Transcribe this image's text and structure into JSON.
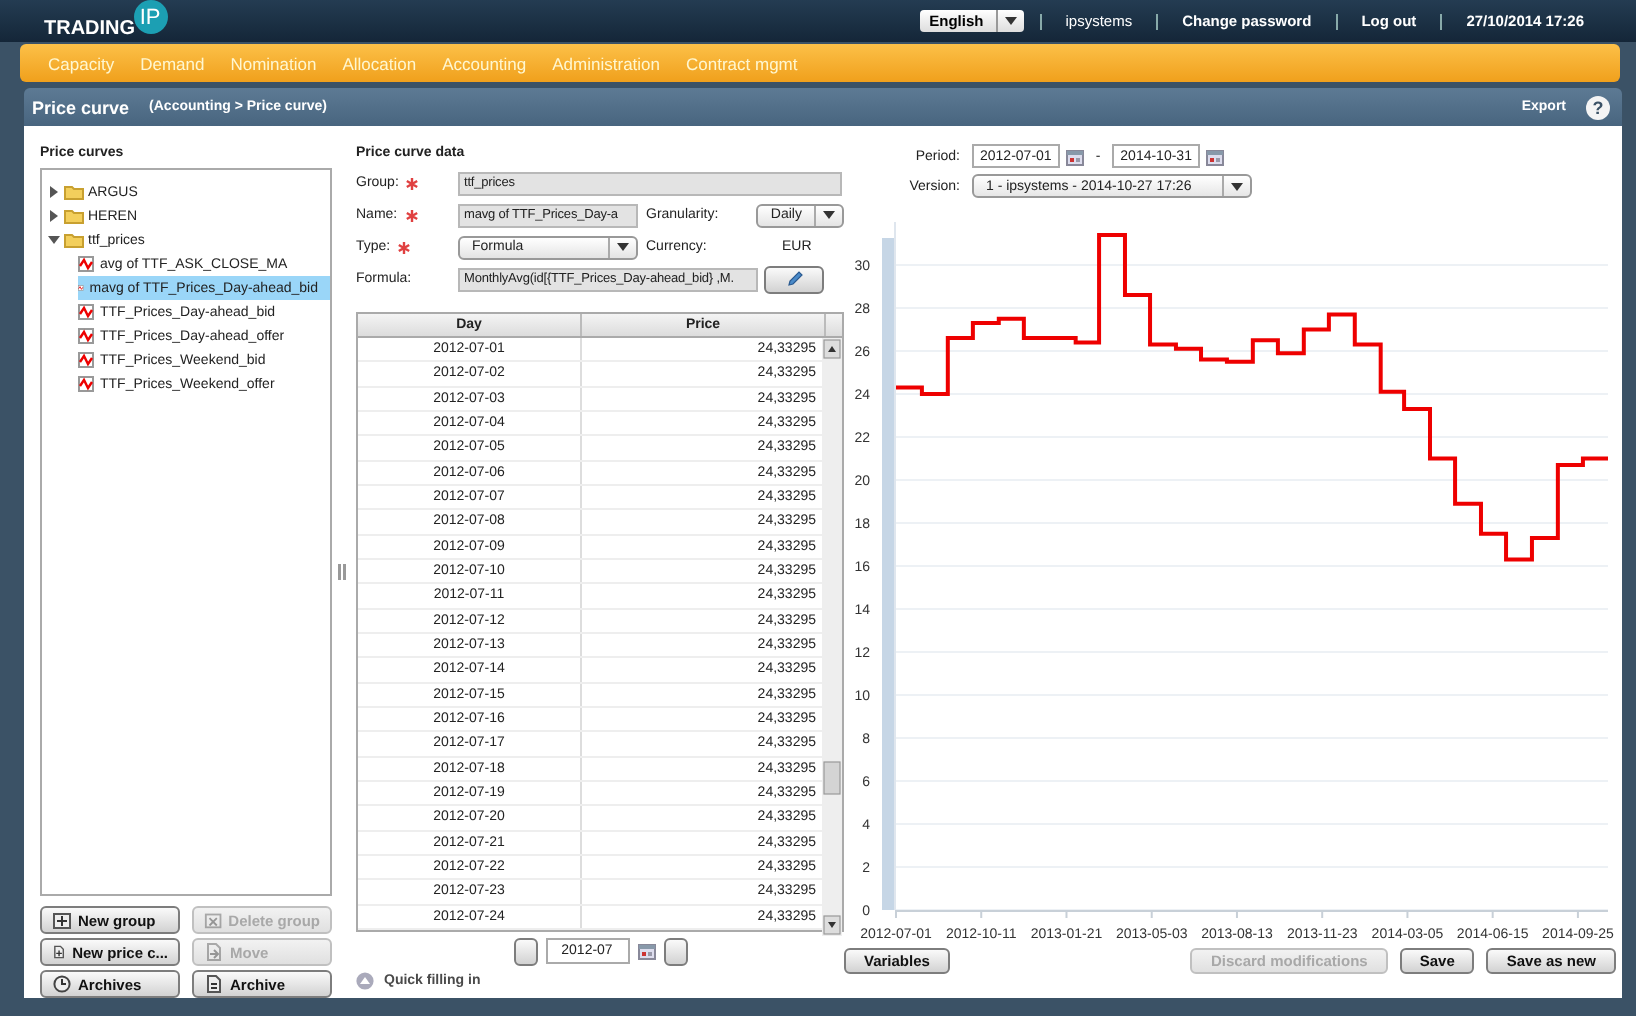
{
  "header": {
    "logo_text": "TRADING",
    "logo_badge": "IP",
    "language": "English",
    "user": "ipsystems",
    "links": [
      "Change password",
      "Log out"
    ],
    "datetime": "27/10/2014 17:26"
  },
  "nav": [
    "Capacity",
    "Demand",
    "Nomination",
    "Allocation",
    "Accounting",
    "Administration",
    "Contract mgmt"
  ],
  "page": {
    "title": "Price curve",
    "breadcrumb": "(Accounting > Price curve)",
    "export": "Export",
    "help": "?"
  },
  "tree": {
    "title": "Price curves",
    "items": [
      {
        "label": "ARGUS",
        "expanded": false
      },
      {
        "label": "HEREN",
        "expanded": false
      },
      {
        "label": "ttf_prices",
        "expanded": true,
        "children": [
          {
            "label": "avg of TTF_ASK_CLOSE_MA",
            "selected": false
          },
          {
            "label": "mavg of TTF_Prices_Day-ahead_bid",
            "selected": true
          },
          {
            "label": "TTF_Prices_Day-ahead_bid",
            "selected": false
          },
          {
            "label": "TTF_Prices_Day-ahead_offer",
            "selected": false
          },
          {
            "label": "TTF_Prices_Weekend_bid",
            "selected": false
          },
          {
            "label": "TTF_Prices_Weekend_offer",
            "selected": false
          }
        ]
      }
    ]
  },
  "tree_buttons": [
    {
      "label": "New group",
      "kind": "addgroup",
      "disabled": false
    },
    {
      "label": "Delete group",
      "kind": "delgroup",
      "disabled": true
    },
    {
      "label": "New price c...",
      "kind": "newcurve",
      "disabled": false
    },
    {
      "label": "Move",
      "kind": "move",
      "disabled": true
    },
    {
      "label": "Archives",
      "kind": "history",
      "disabled": false
    },
    {
      "label": "Archive",
      "kind": "archive",
      "disabled": false
    }
  ],
  "form": {
    "title": "Price curve data",
    "group": {
      "label": "Group:",
      "required": true,
      "value": "ttf_prices"
    },
    "name": {
      "label": "Name:",
      "required": true,
      "value": "mavg of TTF_Prices_Day-a"
    },
    "granularity": {
      "label": "Granularity:",
      "value": "Daily"
    },
    "type": {
      "label": "Type:",
      "required": true,
      "value": "Formula"
    },
    "currency": {
      "label": "Currency:",
      "value": "EUR"
    },
    "formula": {
      "label": "Formula:",
      "value": "MonthlyAvg(id[{TTF_Prices_Day-ahead_bid} ,M."
    }
  },
  "table": {
    "columns": [
      "Day",
      "Price"
    ],
    "rows": [
      [
        "2012-07-01",
        "24,33295"
      ],
      [
        "2012-07-02",
        "24,33295"
      ],
      [
        "2012-07-03",
        "24,33295"
      ],
      [
        "2012-07-04",
        "24,33295"
      ],
      [
        "2012-07-05",
        "24,33295"
      ],
      [
        "2012-07-06",
        "24,33295"
      ],
      [
        "2012-07-07",
        "24,33295"
      ],
      [
        "2012-07-08",
        "24,33295"
      ],
      [
        "2012-07-09",
        "24,33295"
      ],
      [
        "2012-07-10",
        "24,33295"
      ],
      [
        "2012-07-11",
        "24,33295"
      ],
      [
        "2012-07-12",
        "24,33295"
      ],
      [
        "2012-07-13",
        "24,33295"
      ],
      [
        "2012-07-14",
        "24,33295"
      ],
      [
        "2012-07-15",
        "24,33295"
      ],
      [
        "2012-07-16",
        "24,33295"
      ],
      [
        "2012-07-17",
        "24,33295"
      ],
      [
        "2012-07-18",
        "24,33295"
      ],
      [
        "2012-07-19",
        "24,33295"
      ],
      [
        "2012-07-20",
        "24,33295"
      ],
      [
        "2012-07-21",
        "24,33295"
      ],
      [
        "2012-07-22",
        "24,33295"
      ],
      [
        "2012-07-23",
        "24,33295"
      ],
      [
        "2012-07-24",
        "24,33295"
      ]
    ]
  },
  "month_nav": {
    "value": "2012-07"
  },
  "quick_fill": "Quick filling in",
  "period": {
    "label": "Period:",
    "from": "2012-07-01",
    "separator": "-",
    "to": "2014-10-31"
  },
  "version": {
    "label": "Version:",
    "value": "1 - ipsystems - 2014-10-27 17:26"
  },
  "chart_data": {
    "type": "line",
    "x": [
      "2012-07-01",
      "2012-08-01",
      "2012-08-01",
      "2012-09-01",
      "2012-09-01",
      "2012-10-01",
      "2012-10-01",
      "2012-11-01",
      "2012-11-01",
      "2012-12-01",
      "2012-12-01",
      "2013-01-01",
      "2013-01-01",
      "2013-02-01",
      "2013-02-01",
      "2013-03-01",
      "2013-03-01",
      "2013-04-01",
      "2013-04-01",
      "2013-05-01",
      "2013-05-01",
      "2013-06-01",
      "2013-06-01",
      "2013-07-01",
      "2013-07-01",
      "2013-08-01",
      "2013-08-01",
      "2013-09-01",
      "2013-09-01",
      "2013-10-01",
      "2013-10-01",
      "2013-11-01",
      "2013-11-01",
      "2013-12-01",
      "2013-12-01",
      "2014-01-01",
      "2014-01-01",
      "2014-02-01",
      "2014-02-01",
      "2014-03-01",
      "2014-03-01",
      "2014-04-01",
      "2014-04-01",
      "2014-05-01",
      "2014-05-01",
      "2014-06-01",
      "2014-06-01",
      "2014-07-01",
      "2014-07-01",
      "2014-08-01",
      "2014-08-01",
      "2014-09-01",
      "2014-09-01",
      "2014-10-01",
      "2014-10-01",
      "2014-10-31"
    ],
    "series": [
      {
        "color": "#ee0000",
        "values": [
          24.3,
          24.3,
          24.0,
          24.0,
          26.6,
          26.6,
          27.3,
          27.3,
          27.5,
          27.5,
          26.6,
          26.6,
          26.6,
          26.6,
          26.4,
          26.4,
          31.4,
          31.4,
          28.6,
          28.6,
          26.3,
          26.3,
          26.1,
          26.1,
          25.6,
          25.6,
          25.5,
          25.5,
          26.5,
          26.5,
          25.9,
          25.9,
          27.0,
          27.0,
          27.7,
          27.7,
          26.3,
          26.3,
          24.1,
          24.1,
          23.3,
          23.3,
          21.0,
          21.0,
          18.9,
          18.9,
          17.5,
          17.5,
          16.3,
          16.3,
          17.3,
          17.3,
          20.7,
          20.7,
          21.0,
          21.0
        ]
      }
    ],
    "xlim": [
      "2012-07-01",
      "2014-10-31"
    ],
    "ylim": [
      0,
      32
    ],
    "grid": true,
    "xticks": [
      "2012-07-01",
      "2012-10-11",
      "2013-01-21",
      "2013-05-03",
      "2013-08-13",
      "2013-11-23",
      "2014-03-05",
      "2014-06-15",
      "2014-09-25"
    ],
    "yticks": [
      0,
      2,
      4,
      6,
      8,
      10,
      12,
      14,
      16,
      18,
      20,
      22,
      24,
      26,
      28,
      30
    ]
  },
  "actions": [
    {
      "label": "Variables",
      "kind": "left",
      "disabled": false
    },
    {
      "label": "Discard modifications",
      "kind": "right",
      "disabled": true
    },
    {
      "label": "Save",
      "kind": "right",
      "disabled": false
    },
    {
      "label": "Save as new",
      "kind": "right",
      "disabled": false
    }
  ]
}
